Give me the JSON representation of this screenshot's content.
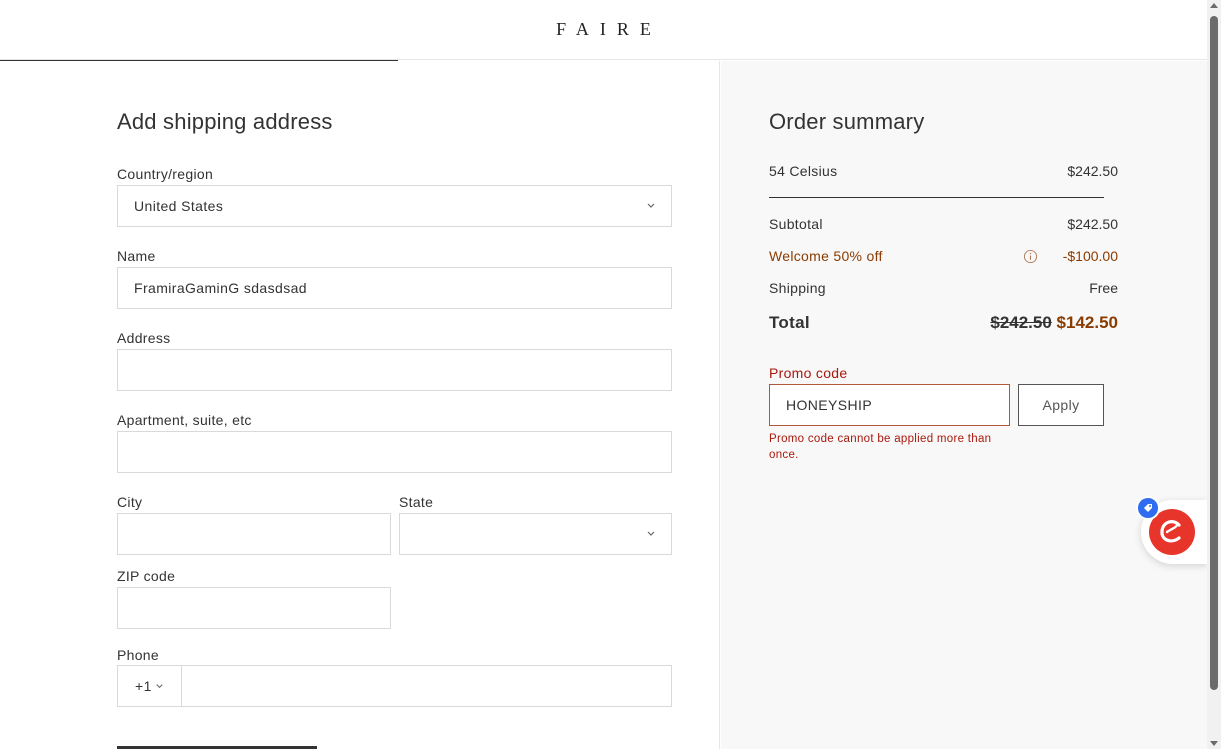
{
  "header": {
    "logo": "FAIRE"
  },
  "form": {
    "title": "Add shipping address",
    "country_label": "Country/region",
    "country_value": "United States",
    "name_label": "Name",
    "name_value": "FramiraGaminG sdasdsad",
    "address_label": "Address",
    "address_value": "",
    "apartment_label": "Apartment, suite, etc",
    "apartment_value": "",
    "city_label": "City",
    "city_value": "",
    "state_label": "State",
    "state_value": "",
    "zip_label": "ZIP code",
    "zip_value": "",
    "phone_label": "Phone",
    "phone_country_code": "+1",
    "phone_value": ""
  },
  "summary": {
    "title": "Order summary",
    "item_name": "54 Celsius",
    "item_price": "$242.50",
    "subtotal_label": "Subtotal",
    "subtotal_value": "$242.50",
    "discount_label": "Welcome 50% off",
    "discount_value": "-$100.00",
    "shipping_label": "Shipping",
    "shipping_value": "Free",
    "total_label": "Total",
    "total_original": "$242.50",
    "total_final": "$142.50",
    "promo_label": "Promo code",
    "promo_value": "HONEYSHIP",
    "apply_label": "Apply",
    "promo_error": "Promo code cannot be applied more than once."
  },
  "colors": {
    "promo_accent": "#8a3b00",
    "error": "#a8190e",
    "extension_red": "#e8352b",
    "extension_badge_blue": "#2f6cf0"
  },
  "icons": {
    "country_dropdown": "chevron-down-icon",
    "state_dropdown": "chevron-down-icon",
    "phone_dropdown": "chevron-down-icon",
    "discount_info": "info-icon",
    "extension": "honey-extension-icon",
    "extension_badge": "tag-icon"
  }
}
